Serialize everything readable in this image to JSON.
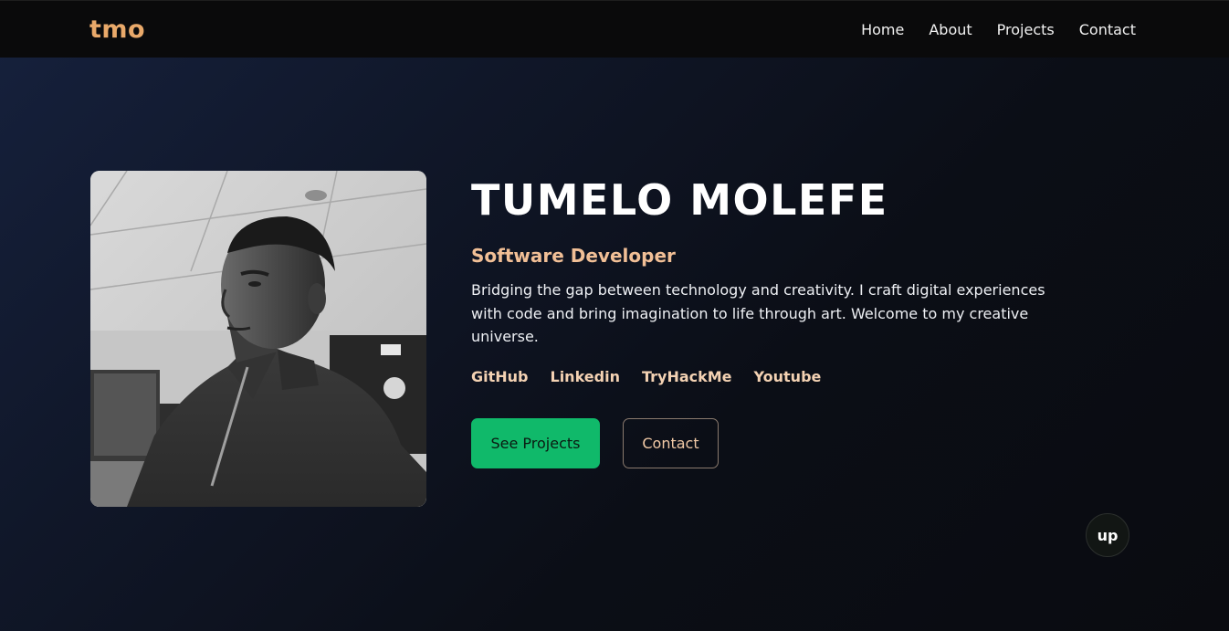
{
  "nav": {
    "logo": "tmo",
    "links": [
      "Home",
      "About",
      "Projects",
      "Contact"
    ]
  },
  "hero": {
    "name": "TUMELO MOLEFE",
    "role": "Software Developer",
    "bio": "Bridging the gap between technology and creativity. I craft digital experiences with code and bring imagination to life through art. Welcome to my creative universe.",
    "social_links": [
      "GitHub",
      "Linkedin",
      "TryHackMe",
      "Youtube"
    ],
    "primary_button": "See Projects",
    "secondary_button": "Contact"
  },
  "scroll_top_button": "up",
  "colors": {
    "accent_logo": "#e9a96a",
    "role_text": "#f1bf96",
    "social_text": "#f4d2b3",
    "primary_button": "#10b96a",
    "navbar_bg": "#0a0a0b",
    "background_start": "#16213d",
    "background_end": "#0a0b10"
  }
}
